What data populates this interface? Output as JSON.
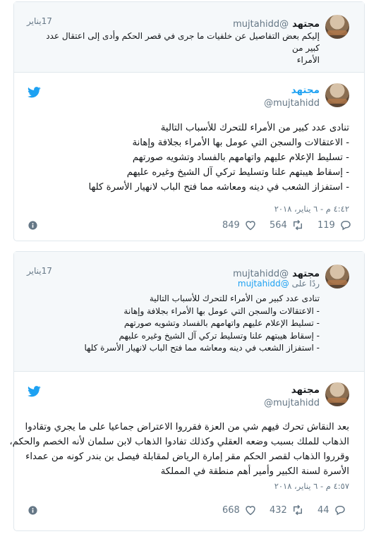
{
  "tweets": [
    {
      "quoted": {
        "name": "مجتهد",
        "handle": "@mujtahidd",
        "time": "17يناير",
        "reply_to_label": "",
        "reply_to_handle": "",
        "text_lines": [
          "إليكم بعض التفاصيل عن خلفيات ما جرى في قصر الحكم وأدى إلى اعتقال عدد كبير من",
          "الأمراء"
        ]
      },
      "main": {
        "name": "مجتهد",
        "handle": "@mujtahidd",
        "text_lines": [
          "تنادى عدد كبير من الأمراء للتحرك للأسباب التالية",
          "- الاعتقالات والسجن التي عومل بها الأمراء بجلافة وإهانة",
          "- تسليط الإعلام عليهم واتهامهم بالفساد وتشويه صورتهم",
          "- إسقاط هيبتهم علنا وتسليط تركي آل الشيخ وغيره عليهم",
          "- استفزاز الشعب في دينه ومعاشه مما فتح الباب لانهيار الأسرة كلها"
        ],
        "date": "٤:٤٢ م - ٦ يناير، ٢٠١٨",
        "likes": "849",
        "retweets": "564",
        "replies": "119"
      }
    },
    {
      "quoted": {
        "name": "مجتهد",
        "handle": "@mujtahidd",
        "time": "17يناير",
        "reply_to_label": "ردًا على",
        "reply_to_handle": "@mujtahidd",
        "text_lines": [
          "تنادى عدد كبير من الأمراء للتحرك للأسباب التالية",
          "- الاعتقالات والسجن التي عومل بها الأمراء بجلافة وإهانة",
          "- تسليط الإعلام عليهم واتهامهم بالفساد وتشويه صورتهم",
          "- إسقاط هيبتهم علنا وتسليط تركي آل الشيخ وغيره عليهم",
          "- استفزاز الشعب في دينه ومعاشه مما فتح الباب لانهيار الأسرة كلها"
        ]
      },
      "main": {
        "name": "مجتهد",
        "handle": "@mujtahidd",
        "text_lines": [
          "بعد النقاش تحرك فيهم شي من العزة فقرروا الاعتراض جماعيا على ما يجري وتقادوا",
          "الذهاب للملك بسبب وضعه العقلي وكذلك تفادوا الذهاب لابن سلمان لأنه الخصم والحكم،",
          "وقرروا الذهاب لقصر الحكم مقر إمارة الرياض لمقابلة فيصل بن بندر كونه من عمداء",
          "الأسرة لسنة الكبير وأمير أهم منطقة في المملكة"
        ],
        "date": "٤:٥٧ م - ٦ يناير، ٢٠١٨",
        "likes": "668",
        "retweets": "432",
        "replies": "44"
      }
    }
  ],
  "icons": {
    "brand": "twitter-bird",
    "like": "heart-outline",
    "retweet": "retweet-arrows",
    "reply": "speech-bubble",
    "info": "info-circle"
  },
  "colors": {
    "brand_blue": "#1da1f2",
    "muted": "#657786",
    "border": "#e1e8ed"
  }
}
